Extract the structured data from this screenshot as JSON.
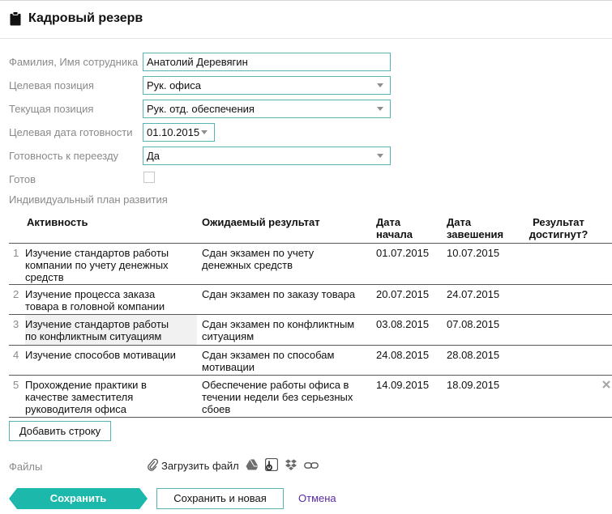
{
  "header": {
    "title": "Кадровый резерв"
  },
  "form": {
    "employee_label": "Фамилия, Имя сотрудника",
    "employee_value": "Анатолий Деревягин",
    "target_position_label": "Целевая позиция",
    "target_position_value": "Рук. офиса",
    "current_position_label": "Текущая позиция",
    "current_position_value": "Рук. отд. обеспечения",
    "target_date_label": "Целевая дата готовности",
    "target_date_value": "01.10.2015",
    "relocation_label": "Готовность к переезду",
    "relocation_value": "Да",
    "ready_label": "Готов",
    "ready_checked": false
  },
  "plan": {
    "title": "Индивидуальный план развития",
    "columns": {
      "activity": "Активность",
      "result": "Ожидаемый результат",
      "start_l1": "Дата",
      "start_l2": "начала",
      "end_l1": "Дата",
      "end_l2": "завешения",
      "achieved_l1": "Результат",
      "achieved_l2": "достигнут?"
    },
    "rows": [
      {
        "num": "1",
        "activity_l1": "Изучение стандартов работы",
        "activity_l2": "компании по учету денежных",
        "activity_l3": "средств",
        "result_l1": "Сдан экзамен по учету",
        "result_l2": "денежных средств",
        "result_l3": "",
        "start": "01.07.2015",
        "end": "10.07.2015"
      },
      {
        "num": "2",
        "activity_l1": "Изучение процесса заказа",
        "activity_l2": "товара в головной компании",
        "activity_l3": "",
        "result_l1": "Сдан экзамен по заказу товара",
        "result_l2": "",
        "result_l3": "",
        "start": "20.07.2015",
        "end": "24.07.2015"
      },
      {
        "num": "3",
        "activity_l1": "Изучение стандартов работы",
        "activity_l2": "по конфликтным ситуациям",
        "activity_l3": "",
        "result_l1": "Сдан экзамен по конфликтным",
        "result_l2": "ситуациям",
        "result_l3": "",
        "start": "03.08.2015",
        "end": "07.08.2015"
      },
      {
        "num": "4",
        "activity_l1": "Изучение способов мотивации",
        "activity_l2": "",
        "activity_l3": "",
        "result_l1": "Сдан экзамен по способам",
        "result_l2": "мотивации",
        "result_l3": "",
        "start": "24.08.2015",
        "end": "28.08.2015"
      },
      {
        "num": "5",
        "activity_l1": "Прохождение практики в",
        "activity_l2": "качестве заместителя",
        "activity_l3": "руководителя офиса",
        "result_l1": "Обеспечение работы офиса в",
        "result_l2": "течении недели без серьезных",
        "result_l3": "сбоев",
        "start": "14.09.2015",
        "end": "18.09.2015",
        "delete_icon": "close-icon"
      }
    ],
    "add_row_label": "Добавить строку"
  },
  "files": {
    "label": "Файлы",
    "upload_label": "Загрузить файл",
    "icons": [
      "paperclip-icon",
      "google-drive-icon",
      "box-icon",
      "dropbox-icon",
      "link-icon"
    ]
  },
  "actions": {
    "save_label": "Сохранить",
    "save_new_label": "Сохранить и новая",
    "cancel_label": "Отмена"
  },
  "colors": {
    "accent": "#1cb8ab",
    "input_border": "#56b5b3",
    "label_gray": "#8a8a8a",
    "cancel_link": "#5a2aa0"
  }
}
